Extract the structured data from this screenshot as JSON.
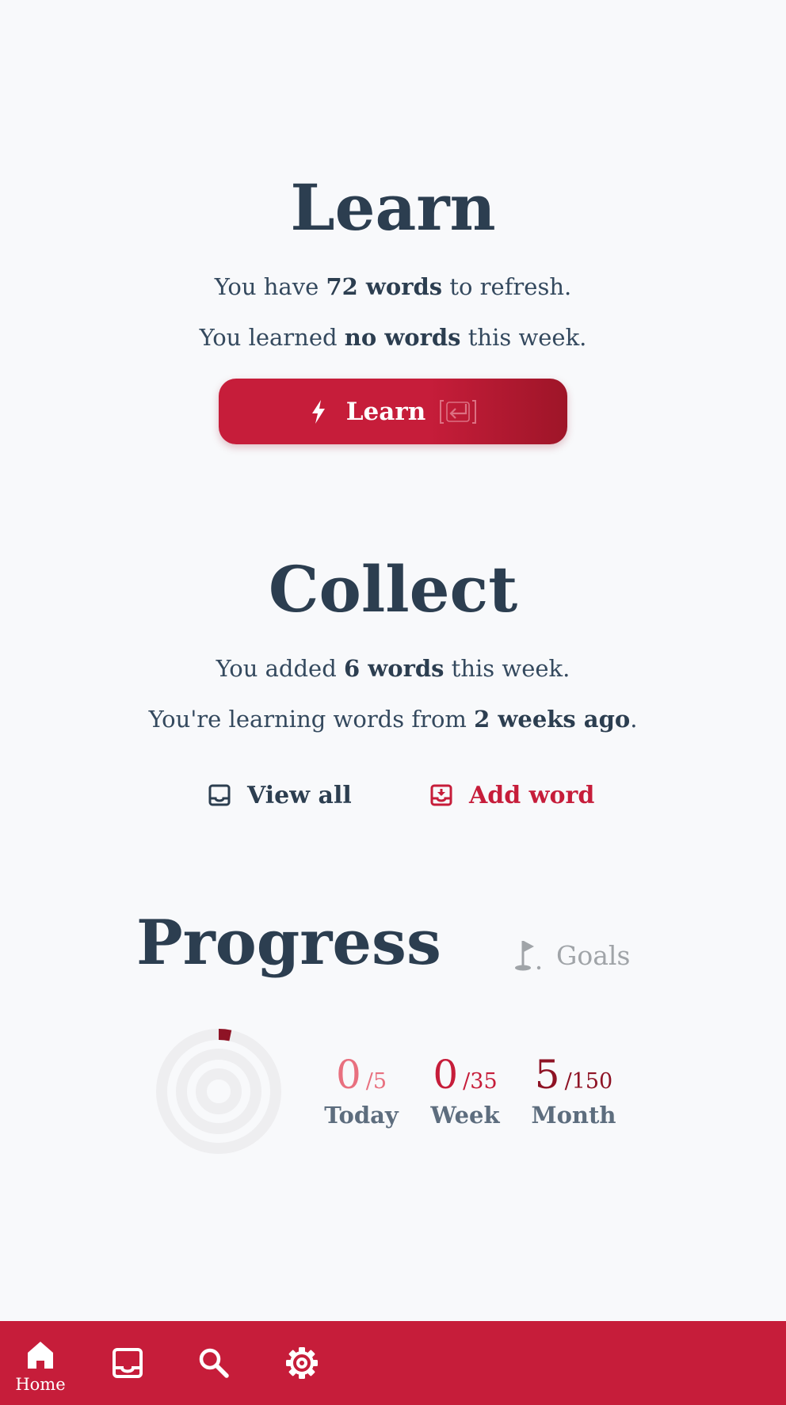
{
  "learn": {
    "title": "Learn",
    "refresh_line": {
      "pre": "You have ",
      "bold": "72 words",
      "post": " to refresh."
    },
    "week_line": {
      "pre": "You learned ",
      "bold": "no words",
      "post": " this week."
    },
    "button": {
      "icon": "lightning-bolt-icon",
      "label": "Learn",
      "shortcut_icon": "enter-key-icon"
    }
  },
  "collect": {
    "title": "Collect",
    "added_line": {
      "pre": "You added ",
      "bold": "6 words",
      "post": " this week."
    },
    "from_line": {
      "pre": "You're learning words from ",
      "bold": "2 weeks ago",
      "post": "."
    },
    "view_all": {
      "icon": "inbox-icon",
      "label": "View all"
    },
    "add_word": {
      "icon": "inbox-download-icon",
      "label": "Add word"
    }
  },
  "progress": {
    "title": "Progress",
    "goals": {
      "icon": "golf-flag-icon",
      "label": "Goals"
    },
    "stats": [
      {
        "value": "0",
        "goal": "/5",
        "caption": "Today",
        "color": "#e8707f"
      },
      {
        "value": "0",
        "goal": "/35",
        "caption": "Week",
        "color": "#c61d3a"
      },
      {
        "value": "5",
        "goal": "/150",
        "caption": "Month",
        "color": "#8e1325"
      }
    ],
    "rings": [
      {
        "name": "today",
        "fraction": 0.0,
        "color": "#e8707f"
      },
      {
        "name": "week",
        "fraction": 0.0,
        "color": "#c61d3a"
      },
      {
        "name": "month",
        "fraction": 0.033,
        "color": "#8e1325"
      }
    ]
  },
  "nav": {
    "items": [
      {
        "icon": "home-icon",
        "label": "Home",
        "active": true
      },
      {
        "icon": "inbox-icon",
        "label": ""
      },
      {
        "icon": "search-icon",
        "label": ""
      },
      {
        "icon": "gear-icon",
        "label": ""
      }
    ]
  },
  "colors": {
    "accent": "#c61d3a",
    "text": "#2c3e50",
    "muted": "#a0a4a8",
    "background": "#f8f9fb"
  }
}
